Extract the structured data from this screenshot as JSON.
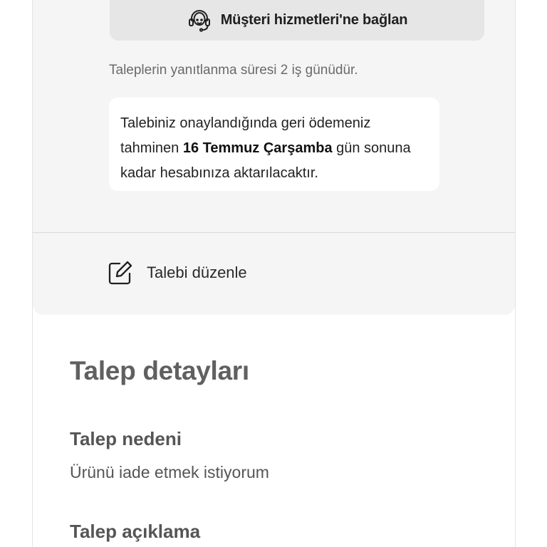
{
  "support": {
    "label": "Müşteri hizmetleri'ne bağlan",
    "icon": "headset-icon"
  },
  "response_note": "Taleplerin yanıtlanma süresi 2 iş günüdür.",
  "refund_info": {
    "before": "Talebiniz onaylandığında geri ödemeniz tahminen ",
    "date": "16 Temmuz Çarşamba",
    "after": " gün sonuna kadar hesabınıza aktarılacaktır."
  },
  "edit": {
    "label": "Talebi düzenle",
    "icon": "edit-icon"
  },
  "details": {
    "title": "Talep detayları",
    "reason_label": "Talep nedeni",
    "reason_value": "Ürünü iade etmek istiyorum",
    "description_label": "Talep açıklama"
  }
}
